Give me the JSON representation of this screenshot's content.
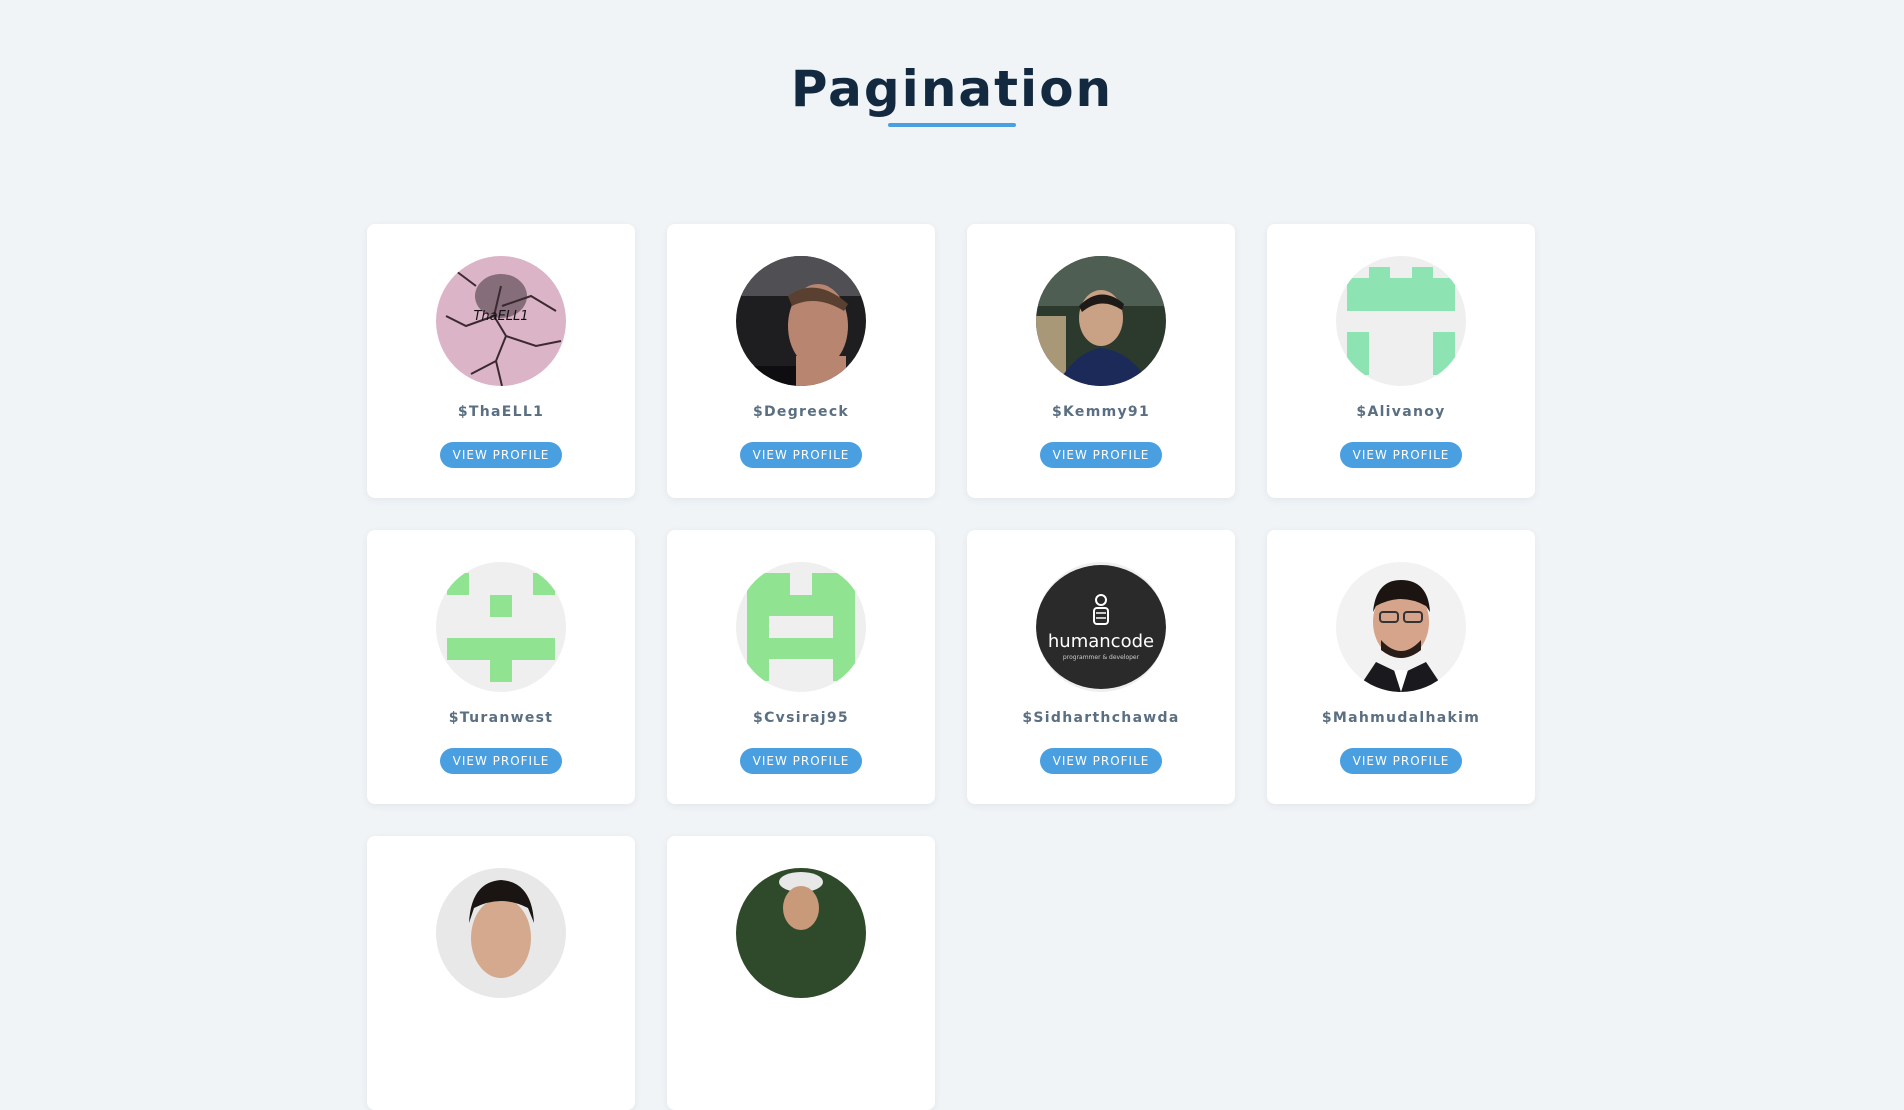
{
  "page": {
    "title": "Pagination"
  },
  "colors": {
    "accent": "#4a9fe0",
    "title": "#12293f",
    "background": "#f0f4f7",
    "username": "#5a6f82"
  },
  "users": [
    {
      "name": "$ThaELL1",
      "button": "VIEW PROFILE",
      "avatar_text": "ThaELL1"
    },
    {
      "name": "$Degreeck",
      "button": "VIEW PROFILE"
    },
    {
      "name": "$Kemmy91",
      "button": "VIEW PROFILE"
    },
    {
      "name": "$Alivanoy",
      "button": "VIEW PROFILE"
    },
    {
      "name": "$Turanwest",
      "button": "VIEW PROFILE"
    },
    {
      "name": "$Cvsiraj95",
      "button": "VIEW PROFILE"
    },
    {
      "name": "$Sidharthchawda",
      "button": "VIEW PROFILE",
      "avatar_text": "humancode",
      "avatar_subtext": "programmer & developer"
    },
    {
      "name": "$Mahmudalhakim",
      "button": "VIEW PROFILE"
    },
    {
      "name": "",
      "button": ""
    },
    {
      "name": "",
      "button": ""
    }
  ]
}
